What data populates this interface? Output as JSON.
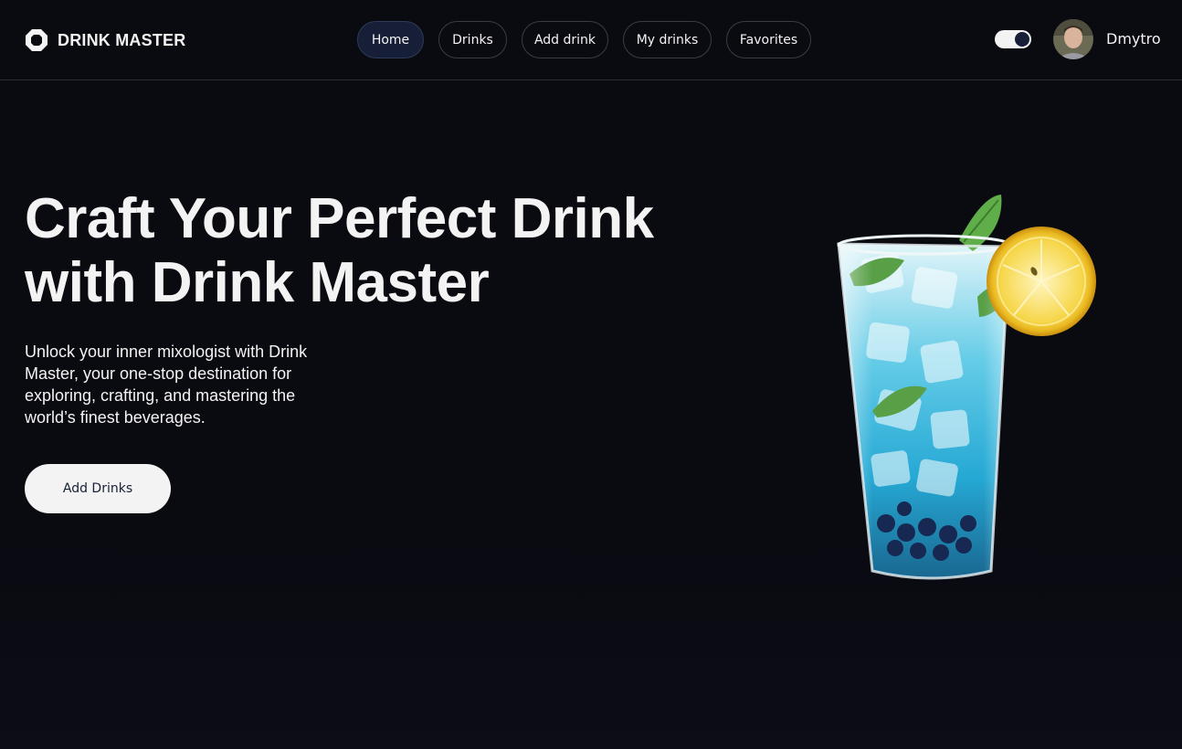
{
  "brand": {
    "name": "DRINK MASTER",
    "icon": "logo-icon"
  },
  "nav": {
    "items": [
      {
        "label": "Home",
        "active": true
      },
      {
        "label": "Drinks",
        "active": false
      },
      {
        "label": "Add drink",
        "active": false
      },
      {
        "label": "My drinks",
        "active": false
      },
      {
        "label": "Favorites",
        "active": false
      }
    ]
  },
  "user": {
    "name": "Dmytro",
    "avatar_icon": "user-avatar"
  },
  "theme_toggle": {
    "state": "dark",
    "icon": "toggle-switch"
  },
  "hero": {
    "title_line1": "Craft Your Perfect Drink",
    "title_line2": "with Drink Master",
    "description": "Unlock your inner mixologist with Drink Master, your one-stop destination for exploring, crafting, and mastering the world’s finest beverages.",
    "cta_label": "Add Drinks",
    "image_icon": "cocktail-glass-image"
  },
  "colors": {
    "background": "#0a0a11",
    "text": "#f3f3f3",
    "active_pill": "#161f37",
    "border": "#3a3c46"
  }
}
